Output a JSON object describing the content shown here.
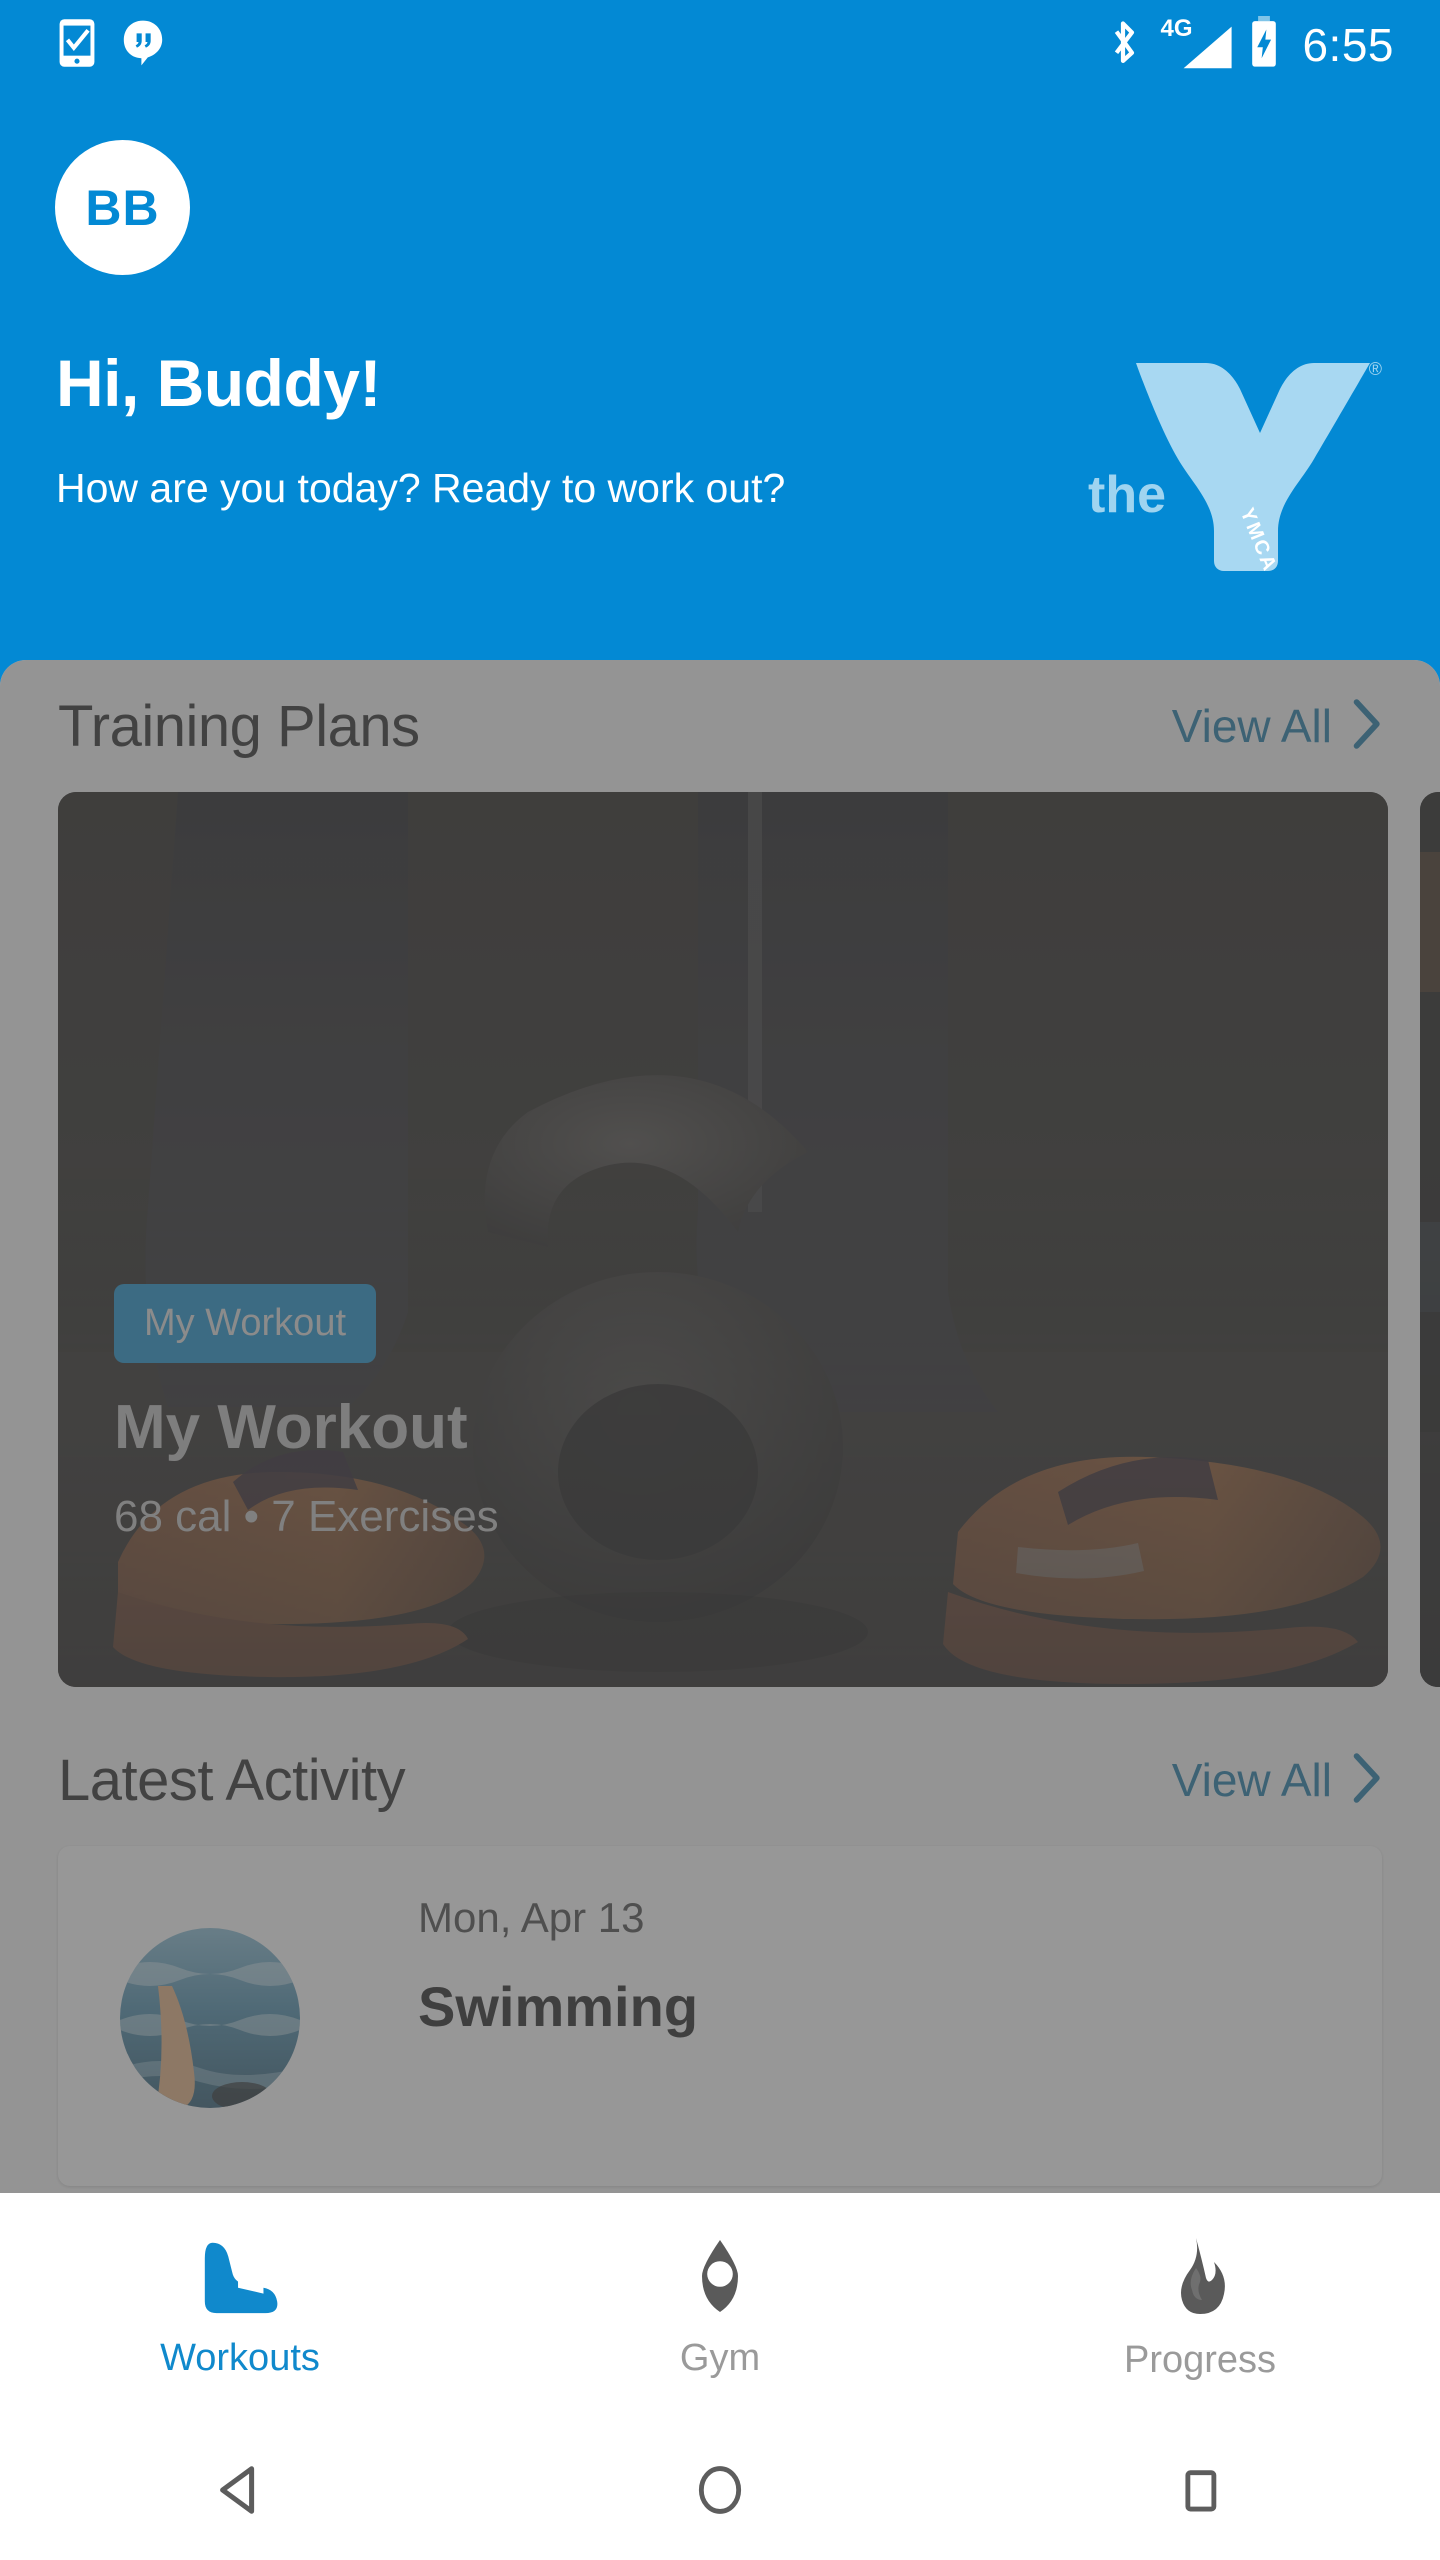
{
  "status_bar": {
    "time": "6:55",
    "network": "4G",
    "icons": [
      "sms-check-icon",
      "hangouts-icon",
      "bluetooth-icon",
      "signal-icon",
      "battery-charging-icon"
    ]
  },
  "header": {
    "avatar_initials": "BB",
    "greeting": "Hi, Buddy!",
    "subgreeting": "How are you today? Ready to work out?",
    "brand": {
      "prefix": "the",
      "mark": "YMCA",
      "registered": "®"
    },
    "bg_color": "#0389d4"
  },
  "sections": [
    {
      "title": "Training Plans",
      "view_all_label": "View All",
      "cards": [
        {
          "badge": "My Workout",
          "title": "My Workout",
          "meta": "68 cal • 7 Exercises",
          "calories": 68,
          "exercises": 7
        },
        {
          "badge": "",
          "title": "",
          "meta": ""
        }
      ]
    },
    {
      "title": "Latest Activity",
      "view_all_label": "View All",
      "items": [
        {
          "date": "Mon, Apr 13",
          "name": "Swimming"
        }
      ]
    }
  ],
  "bottom_nav": {
    "items": [
      {
        "label": "Workouts",
        "icon": "running-shoe-icon",
        "active": true
      },
      {
        "label": "Gym",
        "icon": "location-pin-icon",
        "active": false
      },
      {
        "label": "Progress",
        "icon": "flame-icon",
        "active": false
      }
    ],
    "active_color": "#1089cc",
    "inactive_color": "#9a9a9a"
  },
  "system_nav": {
    "back": "back-triangle-icon",
    "home": "home-circle-icon",
    "recents": "recents-square-icon"
  },
  "overlay": {
    "scrim_color": "#5a5a5a",
    "active": true
  }
}
